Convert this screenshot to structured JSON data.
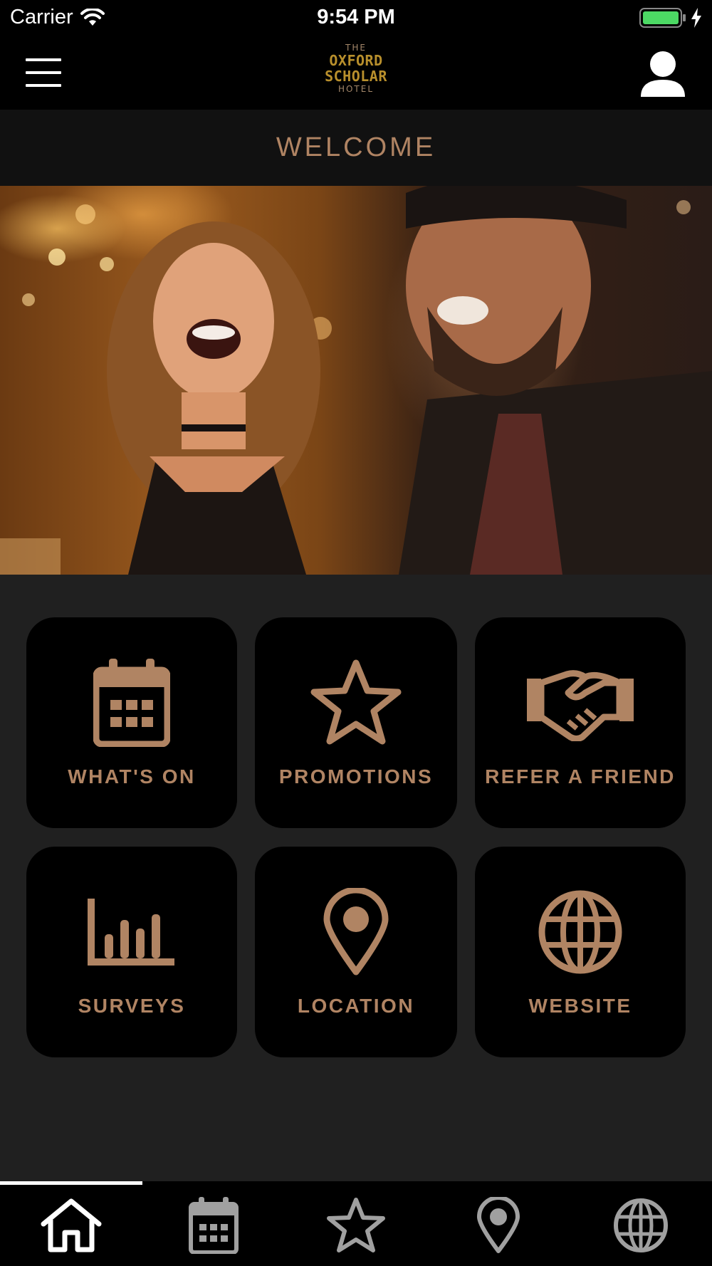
{
  "status_bar": {
    "carrier": "Carrier",
    "time": "9:54 PM",
    "battery_color": "#4cd964"
  },
  "header": {
    "logo": {
      "line1": "THE",
      "line2": "OXFORD",
      "line3": "SCHOLAR",
      "line4": "HOTEL"
    },
    "menu_icon": "hamburger-icon",
    "profile_icon": "user-icon"
  },
  "welcome": {
    "title": "WELCOME"
  },
  "hero": {
    "image": "couple-laughing-at-bar-photo"
  },
  "tiles": [
    {
      "label": "WHAT'S ON",
      "icon": "calendar-icon"
    },
    {
      "label": "PROMOTIONS",
      "icon": "star-icon"
    },
    {
      "label": "REFER A FRIEND",
      "icon": "handshake-icon"
    },
    {
      "label": "SURVEYS",
      "icon": "bar-chart-icon"
    },
    {
      "label": "LOCATION",
      "icon": "map-pin-icon"
    },
    {
      "label": "WEBSITE",
      "icon": "globe-icon"
    }
  ],
  "tab_bar": {
    "tabs": [
      {
        "icon": "home-icon",
        "selected": true
      },
      {
        "icon": "calendar-icon",
        "selected": false
      },
      {
        "icon": "star-icon",
        "selected": false
      },
      {
        "icon": "map-pin-icon",
        "selected": false
      },
      {
        "icon": "globe-icon",
        "selected": false
      }
    ]
  },
  "colors": {
    "accent": "#b08463",
    "tile_bg": "#000000",
    "page_bg": "#202020",
    "logo_gold": "#b88f2c"
  }
}
